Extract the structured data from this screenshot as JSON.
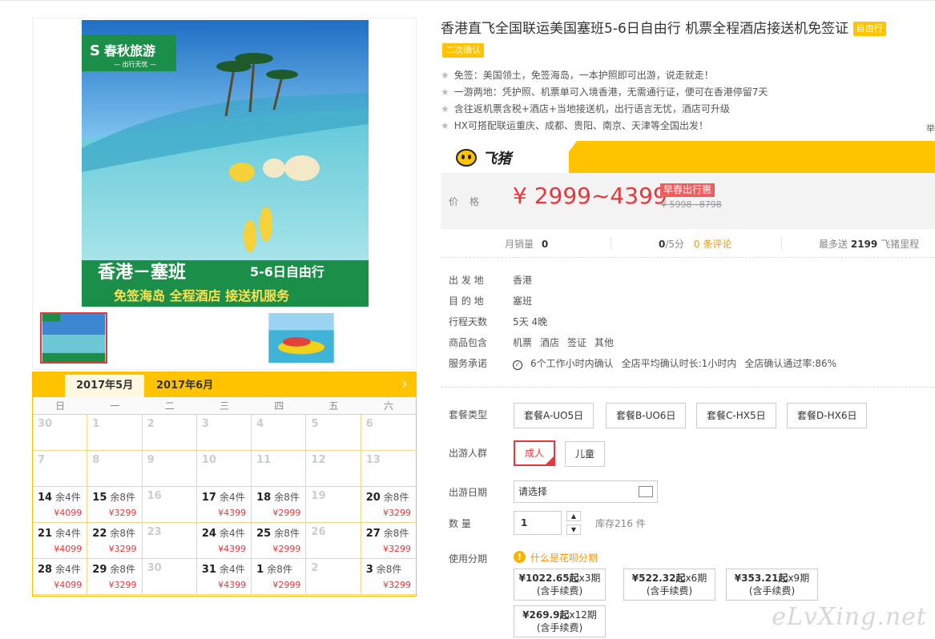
{
  "product": {
    "title": "香港直飞全国联运美国塞班5-6日自由行 机票全程酒店接送机免签证",
    "tag_free": "自由行",
    "tag_confirm": "二次确认",
    "features": [
      "免签：美国领土，免签海岛，一本护照即可出游，说走就走！",
      "一游两地：凭护照、机票单可入境香港，无需通行证，便可在香港停留7天",
      "含往返机票含税+酒店+当地接送机，出行语言无忧，酒店可升级",
      "HX可搭配联运重庆、成都、贵阳、南京、天津等全国出发！"
    ],
    "edge_char": "举"
  },
  "banner": {
    "brand_text": "春秋旅游",
    "brand_sub": "— 出行无忧 —",
    "headline": "香港－塞班",
    "headline_days": "5-6日自由行",
    "subline": "免签海岛 全程酒店 接送机服务"
  },
  "brand": {
    "name": "飞猪"
  },
  "price": {
    "label": "价格",
    "value": "¥ 2999~4399",
    "promo": "早春出行惠",
    "old": "¥ 5998~8798"
  },
  "stats": {
    "monthly_label": "月销量",
    "monthly_value": "0",
    "score_value": "0",
    "score_suffix": "/5分",
    "reviews": "0 条评论",
    "miles_prefix": "最多送",
    "miles_value": "2199",
    "miles_suffix": "飞猪里程"
  },
  "props": {
    "depart_label": "出 发 地",
    "depart": "香港",
    "dest_label": "目 的 地",
    "dest": "塞班",
    "days_label": "行程天数",
    "days": "5天 4晚",
    "include_label": "商品包含",
    "includes": [
      "机票",
      "酒店",
      "签证",
      "其他"
    ],
    "service_label": "服务承诺",
    "service_1": "6个工作小时内确认",
    "service_2": "全店平均确认时长:1小时内",
    "service_3": "全店确认通过率:86%"
  },
  "options": {
    "package_label": "套餐类型",
    "packages": [
      "套餐A-UO5日",
      "套餐B-UO6日",
      "套餐C-HX5日",
      "套餐D-HX6日"
    ],
    "people_label": "出游人群",
    "people": [
      "成人",
      "儿童"
    ],
    "date_label": "出游日期",
    "date_placeholder": "请选择",
    "qty_label": "数 量",
    "qty_value": "1",
    "stock": "库存216 件",
    "installment_label": "使用分期",
    "huabei": "什么是花呗分期",
    "installments": [
      {
        "price": "¥1022.65起",
        "term": "x3期",
        "fee": "(含手续费)"
      },
      {
        "price": "¥522.32起",
        "term": "x6期",
        "fee": "(含手续费)"
      },
      {
        "price": "¥353.21起",
        "term": "x9期",
        "fee": "(含手续费)"
      },
      {
        "price": "¥269.9起",
        "term": "x12期",
        "fee": "(含手续费)"
      }
    ]
  },
  "calendar": {
    "tab_active": "2017年5月",
    "tab_other": "2017年6月",
    "weekdays": [
      "日",
      "一",
      "二",
      "三",
      "四",
      "五",
      "六"
    ],
    "cells": [
      {
        "d": "30"
      },
      {
        "d": "1"
      },
      {
        "d": "2"
      },
      {
        "d": "3"
      },
      {
        "d": "4"
      },
      {
        "d": "5"
      },
      {
        "d": "6"
      },
      {
        "d": "7"
      },
      {
        "d": "8"
      },
      {
        "d": "9"
      },
      {
        "d": "10"
      },
      {
        "d": "11"
      },
      {
        "d": "12"
      },
      {
        "d": "13"
      },
      {
        "d": "14",
        "l": "余4件",
        "p": "¥4099"
      },
      {
        "d": "15",
        "l": "余8件",
        "p": "¥3299"
      },
      {
        "d": "16"
      },
      {
        "d": "17",
        "l": "余4件",
        "p": "¥4399"
      },
      {
        "d": "18",
        "l": "余8件",
        "p": "¥2999"
      },
      {
        "d": "19"
      },
      {
        "d": "20",
        "l": "余8件",
        "p": "¥3299"
      },
      {
        "d": "21",
        "l": "余4件",
        "p": "¥4099"
      },
      {
        "d": "22",
        "l": "余8件",
        "p": "¥3299"
      },
      {
        "d": "23"
      },
      {
        "d": "24",
        "l": "余4件",
        "p": "¥4399"
      },
      {
        "d": "25",
        "l": "余8件",
        "p": "¥2999"
      },
      {
        "d": "26"
      },
      {
        "d": "27",
        "l": "余8件",
        "p": "¥3299"
      },
      {
        "d": "28",
        "l": "余4件",
        "p": "¥4099"
      },
      {
        "d": "29",
        "l": "余8件",
        "p": "¥3299"
      },
      {
        "d": "30"
      },
      {
        "d": "31",
        "l": "余4件",
        "p": "¥4399"
      },
      {
        "d": "1",
        "l": "余8件",
        "p": "¥2999"
      },
      {
        "d": "2"
      },
      {
        "d": "3",
        "l": "余8件",
        "p": "¥3299"
      }
    ]
  },
  "watermark": "eLvXing.net",
  "colors": {
    "accent": "#ffc300",
    "price": "#e4393c",
    "link": "#f39800"
  }
}
